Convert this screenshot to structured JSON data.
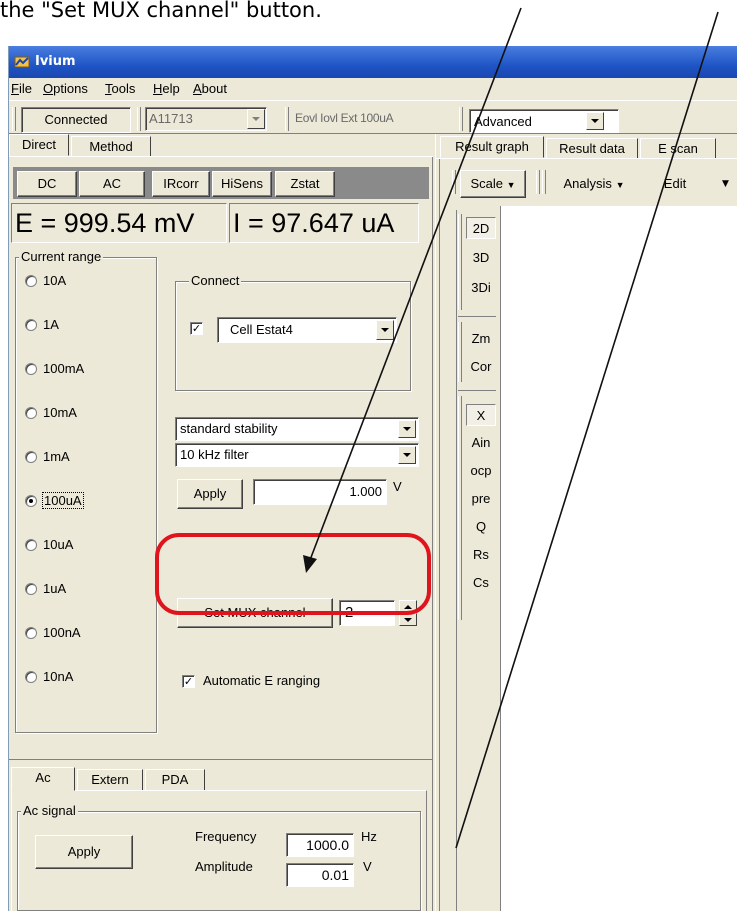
{
  "caption": "the \"Set MUX channel\" button.",
  "window": {
    "title": "Ivium"
  },
  "menu": {
    "file": "File",
    "options": "Options",
    "tools": "Tools",
    "help": "Help",
    "about": "About"
  },
  "toolbar": {
    "connected": "Connected",
    "device": "A11713",
    "status": "Eovl Iovl Ext 100uA",
    "mode": "Advanced"
  },
  "left_tabs": {
    "direct": "Direct",
    "method": "Method"
  },
  "mode_buttons": {
    "dc": "DC",
    "ac": "AC",
    "ircorr": "IRcorr",
    "hisens": "HiSens",
    "zstat": "Zstat"
  },
  "readout": {
    "e": "E = 999.54 mV",
    "i": "I = 97.647 uA"
  },
  "current_range": {
    "title": "Current range",
    "options": [
      "10A",
      "1A",
      "100mA",
      "10mA",
      "1mA",
      "100uA",
      "10uA",
      "1uA",
      "100nA",
      "10nA"
    ],
    "selected": "100uA"
  },
  "connect": {
    "title": "Connect",
    "cell": "Cell Estat4"
  },
  "stability": "standard stability",
  "filter": "10 kHz filter",
  "apply_label": "Apply",
  "voltage": {
    "value": "1.000",
    "unit": "V"
  },
  "mux": {
    "button": "Set MUX channel",
    "value": "2"
  },
  "auto_range": "Automatic E ranging",
  "bottom_tabs": {
    "ac": "Ac",
    "extern": "Extern",
    "pda": "PDA"
  },
  "ac_signal": {
    "title": "Ac signal",
    "apply": "Apply",
    "frequency_label": "Frequency",
    "frequency_value": "1000.0",
    "frequency_unit": "Hz",
    "amplitude_label": "Amplitude",
    "amplitude_value": "0.01",
    "amplitude_unit": "V"
  },
  "right_tabs": {
    "graph": "Result graph",
    "data": "Result data",
    "escan": "E scan"
  },
  "right_toolbar": {
    "scale": "Scale",
    "analysis": "Analysis",
    "edit": "Edit"
  },
  "side_buttons": [
    "2D",
    "3D",
    "3Di",
    "Zm",
    "Cor",
    "X",
    "Ain",
    "ocp",
    "pre",
    "Q",
    "Rs",
    "Cs"
  ],
  "colors": {
    "highlight": "#e0141c",
    "titlebar": "#1f55c6"
  }
}
